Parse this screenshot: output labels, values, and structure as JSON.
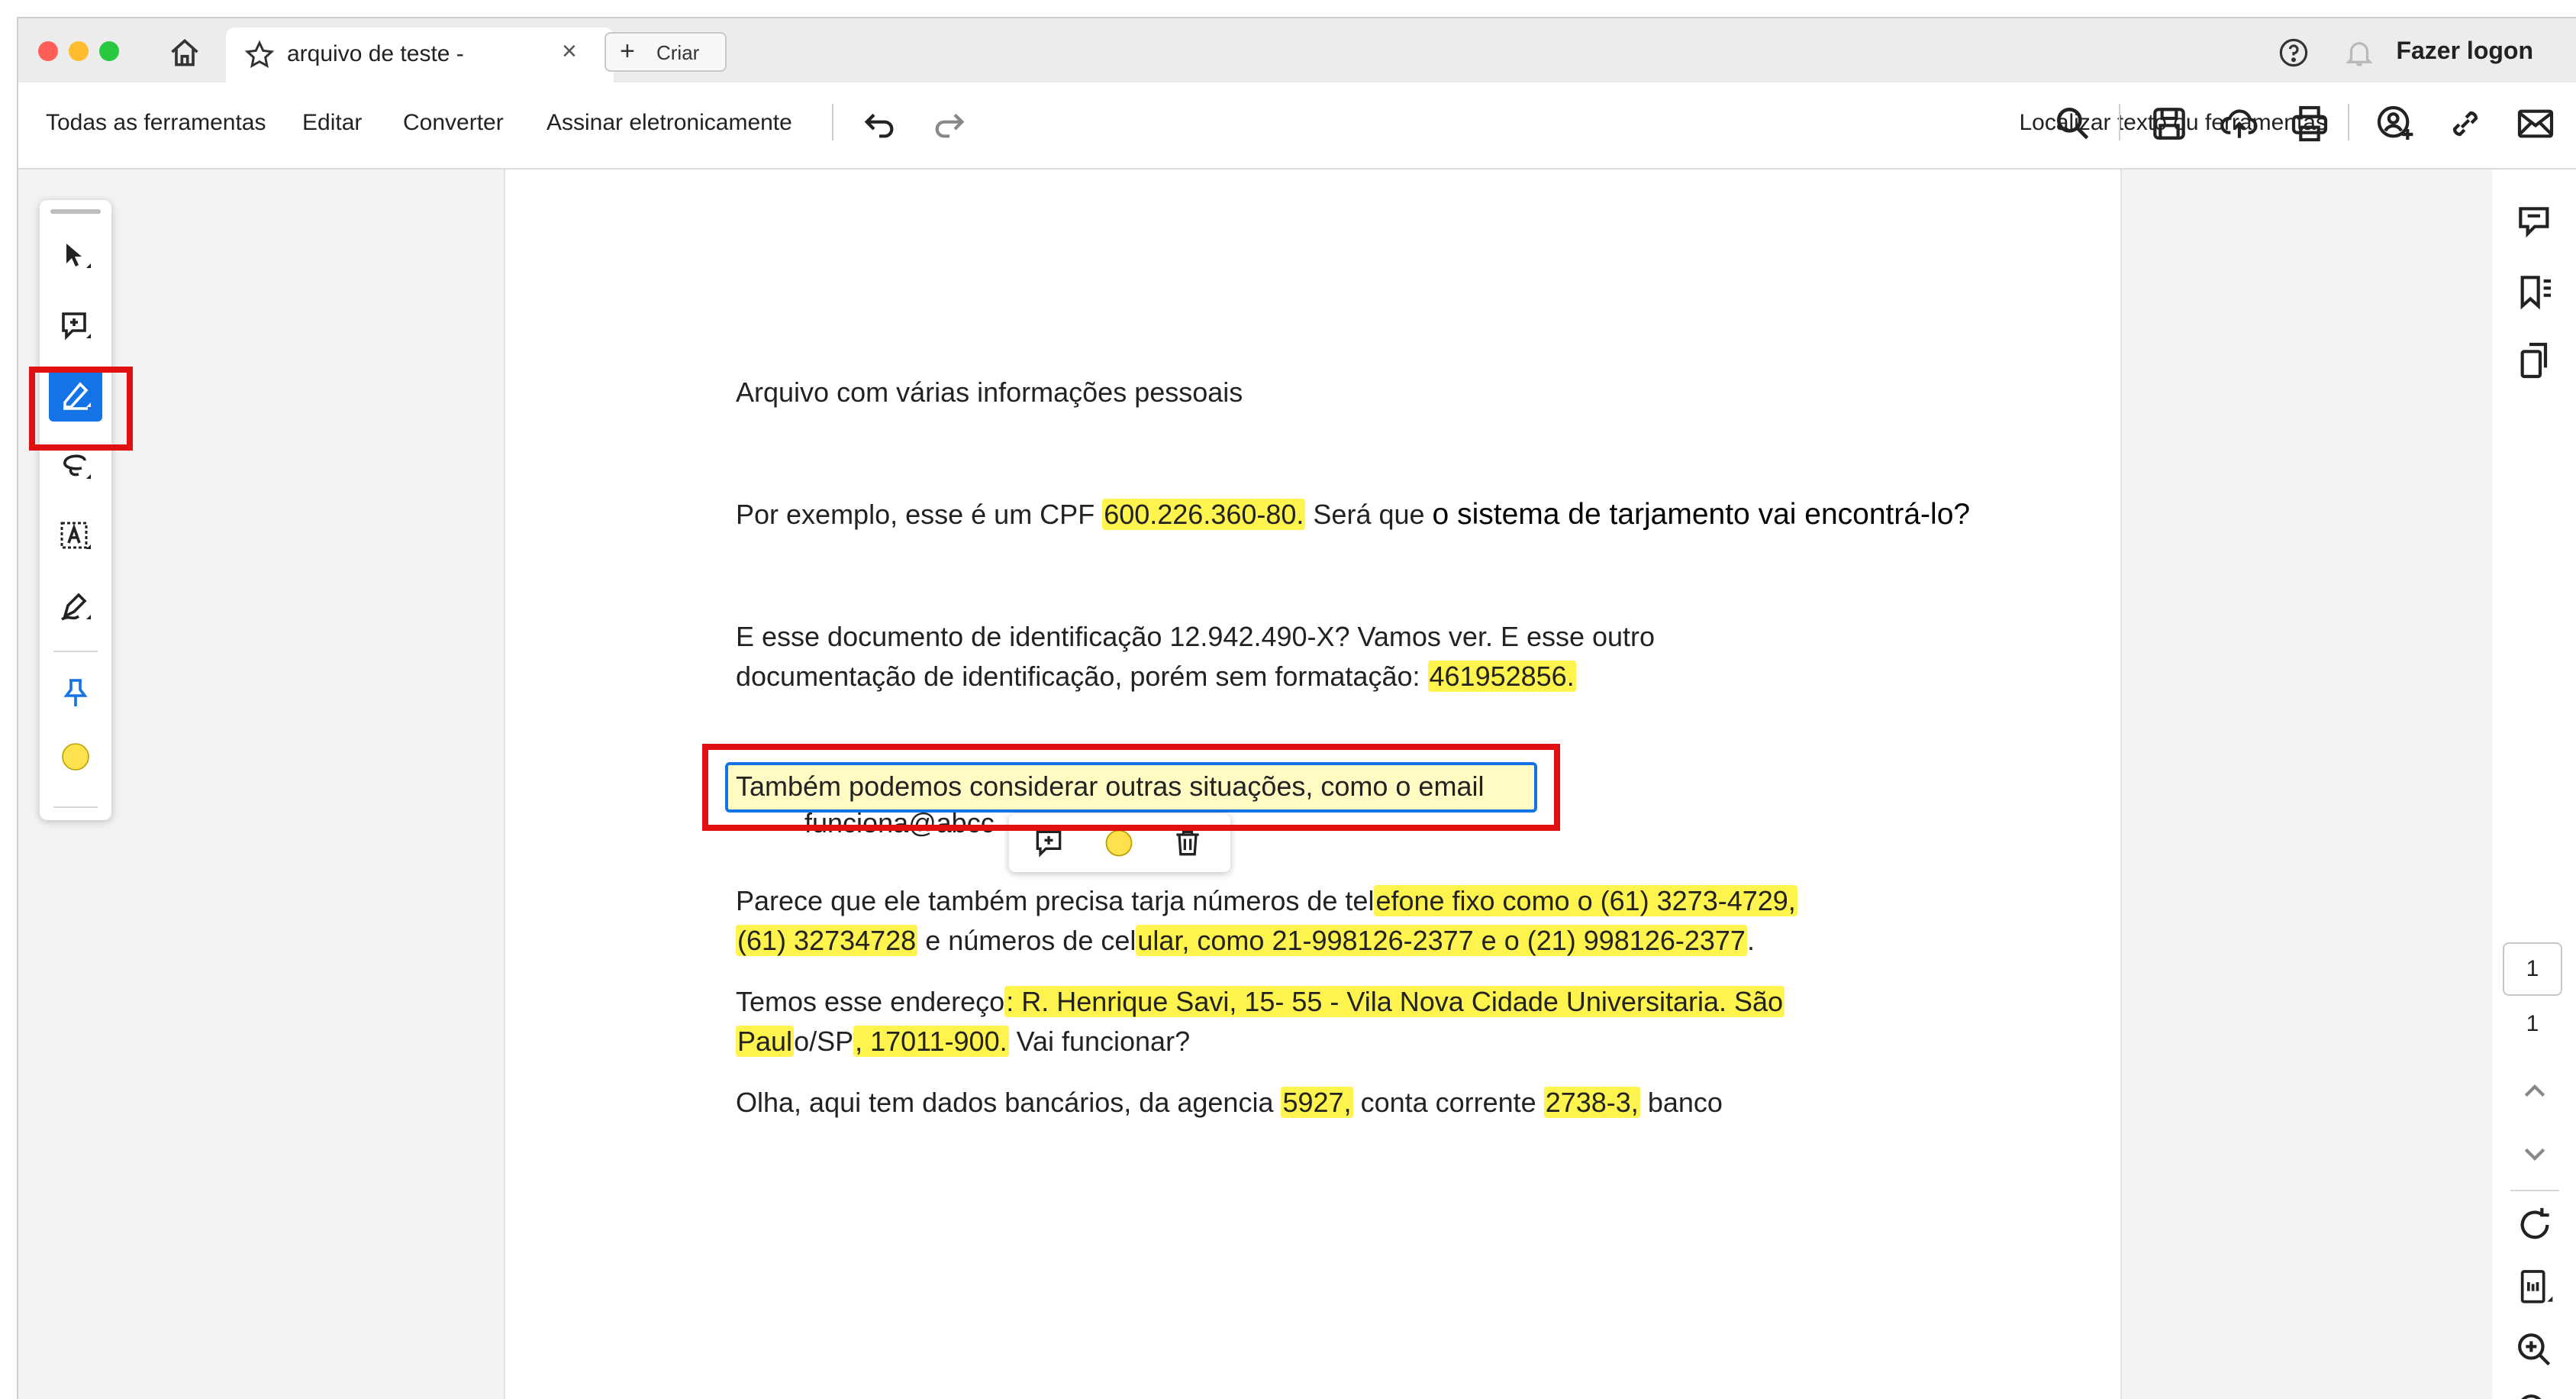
{
  "titlebar": {
    "tab_title": "arquivo de teste -",
    "tab_close": "×",
    "new_tab_label": "Criar",
    "new_tab_plus": "+",
    "sign_in": "Fazer logon"
  },
  "toolbar": {
    "menu": [
      "Todas as ferramentas",
      "Editar",
      "Converter",
      "Assinar eletronicamente"
    ],
    "search_label": "Localizar texto ou ferramentas"
  },
  "document": {
    "title_line": "Arquivo com várias informações pessoais",
    "cpf_before": "Por exemplo, esse é um CPF ",
    "cpf_value": "600.226.360-80.",
    "cpf_after_a": " Será que ",
    "cpf_after_b": "o sistema de tarjamento vai encontrá-lo?",
    "id_line1": "E esse documento de identificação 12.942.490-X? Vamos ver. E esse outro",
    "id_line2_before": "documentação de identificação, porém sem formatação: ",
    "id_line2_value": "461952856.",
    "email_line1": "Também podemos considerar outras situações, como o email",
    "email_line2": "funciona@abcc",
    "phone_line1_before": "Parece que ele também precisa tarja números de tel",
    "phone_line1_hl": "efone fixo como o (61) 3273-4729,",
    "phone_line2_hl1": "(61) 32734728",
    "phone_line2_mid": " e números de cel",
    "phone_line2_hl2": "ular, como 21-998126-2377 e o (21) 998126-2377",
    "phone_line2_end": ".",
    "addr_line1_before": "Temos esse endereço",
    "addr_line1_hl": ": R. Henrique Savi, 15- 55 - Vila Nova Cidade Universitaria. São",
    "addr_line2_hl1": "Paul",
    "addr_line2_mid": "o/SP",
    "addr_line2_hl2": ", 17011-900.",
    "addr_line2_end": " Vai funcionar?",
    "bank_before": "Olha, aqui tem dados bancários, da agencia ",
    "bank_agency": "5927,",
    "bank_mid": " conta corrente ",
    "bank_account": "2738-3,",
    "bank_after": " banco"
  },
  "right_rail": {
    "current_page": "1",
    "total_pages": "1"
  },
  "colors": {
    "highlight": "#fff34d",
    "accent_blue": "#1473e6",
    "annotation_red": "#e01010",
    "note_yellow": "#fde24d"
  },
  "icons": [
    "home-icon",
    "star-icon",
    "help-icon",
    "bell-icon",
    "undo-icon",
    "redo-icon",
    "search-icon",
    "save-icon",
    "cloud-upload-icon",
    "print-icon",
    "share-user-icon",
    "link-icon",
    "mail-icon",
    "select-arrow-icon",
    "add-comment-icon",
    "highlight-pen-icon",
    "lasso-draw-icon",
    "text-box-icon",
    "signature-icon",
    "pin-icon",
    "color-circle-icon",
    "comments-panel-icon",
    "bookmarks-icon",
    "pages-icon",
    "chevron-up-icon",
    "chevron-down-icon",
    "rotate-icon",
    "fit-page-icon",
    "zoom-in-icon",
    "zoom-out-icon",
    "delete-icon"
  ]
}
